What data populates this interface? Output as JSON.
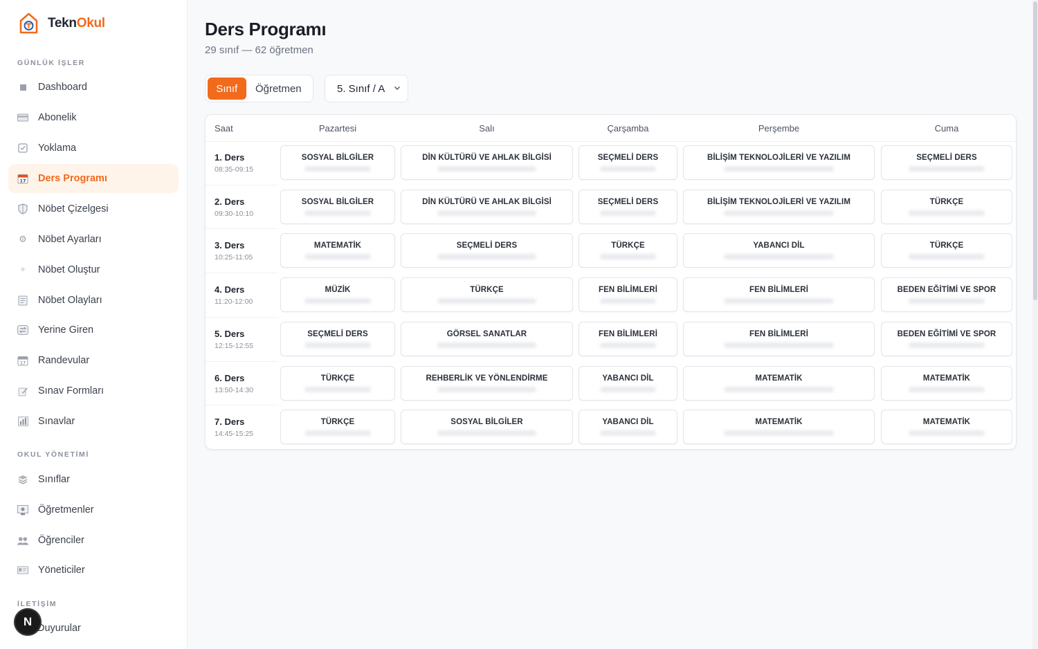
{
  "brand": {
    "name_part1": "Tekn",
    "name_part2": "Okul",
    "logo_color": "#f26a1b"
  },
  "sidebar": {
    "sections": [
      {
        "title": "GÜNLÜK İŞLER",
        "items": [
          {
            "label": "Dashboard",
            "icon": "square-icon",
            "active": false
          },
          {
            "label": "Abonelik",
            "icon": "card-icon",
            "active": false
          },
          {
            "label": "Yoklama",
            "icon": "checkbox-icon",
            "active": false
          },
          {
            "label": "Ders Programı",
            "icon": "calendar-icon",
            "active": true
          },
          {
            "label": "Nöbet Çizelgesi",
            "icon": "shield-icon",
            "active": false
          },
          {
            "label": "Nöbet Ayarları",
            "icon": "gear-icon",
            "active": false
          },
          {
            "label": "Nöbet Oluştur",
            "icon": "sparkle-icon",
            "active": false
          },
          {
            "label": "Nöbet Olayları",
            "icon": "document-icon",
            "active": false
          },
          {
            "label": "Yerine Giren",
            "icon": "swap-icon",
            "active": false
          },
          {
            "label": "Randevular",
            "icon": "calendar-icon",
            "active": false
          },
          {
            "label": "Sınav Formları",
            "icon": "pencil-icon",
            "active": false
          },
          {
            "label": "Sınavlar",
            "icon": "bar-chart-icon",
            "active": false
          }
        ]
      },
      {
        "title": "OKUL YÖNETİMİ",
        "items": [
          {
            "label": "Sınıflar",
            "icon": "books-icon",
            "active": false
          },
          {
            "label": "Öğretmenler",
            "icon": "teacher-icon",
            "active": false
          },
          {
            "label": "Öğrenciler",
            "icon": "users-icon",
            "active": false
          },
          {
            "label": "Yöneticiler",
            "icon": "id-card-icon",
            "active": false
          }
        ]
      },
      {
        "title": "İLETİŞİM",
        "items": [
          {
            "label": "Duyurular",
            "icon": "megaphone-icon",
            "active": false
          }
        ]
      }
    ],
    "avatar_letter": "N"
  },
  "header": {
    "title": "Ders Programı",
    "subtitle": "29 sınıf — 62 öğretmen"
  },
  "toolbar": {
    "toggle_class": "Sınıf",
    "toggle_teacher": "Öğretmen",
    "class_select_value": "5. Sınıf / A"
  },
  "schedule": {
    "time_header": "Saat",
    "days": [
      "Pazartesi",
      "Salı",
      "Çarşamba",
      "Perşembe",
      "Cuma"
    ],
    "periods": [
      {
        "name": "1. Ders",
        "time": "08:35-09:15",
        "subjects": [
          "SOSYAL BİLGİLER",
          "DİN KÜLTÜRÜ VE AHLAK BİLGİSİ",
          "SEÇMELİ DERS",
          "BİLİŞİM TEKNOLOJİLERİ VE YAZILIM",
          "SEÇMELİ DERS"
        ]
      },
      {
        "name": "2. Ders",
        "time": "09:30-10:10",
        "subjects": [
          "SOSYAL BİLGİLER",
          "DİN KÜLTÜRÜ VE AHLAK BİLGİSİ",
          "SEÇMELİ DERS",
          "BİLİŞİM TEKNOLOJİLERİ VE YAZILIM",
          "TÜRKÇE"
        ]
      },
      {
        "name": "3. Ders",
        "time": "10:25-11:05",
        "subjects": [
          "MATEMATİK",
          "SEÇMELİ DERS",
          "TÜRKÇE",
          "YABANCI DİL",
          "TÜRKÇE"
        ]
      },
      {
        "name": "4. Ders",
        "time": "11:20-12:00",
        "subjects": [
          "MÜZİK",
          "TÜRKÇE",
          "FEN BİLİMLERİ",
          "FEN BİLİMLERİ",
          "BEDEN EĞİTİMİ VE SPOR"
        ]
      },
      {
        "name": "5. Ders",
        "time": "12:15-12:55",
        "subjects": [
          "SEÇMELİ DERS",
          "GÖRSEL SANATLAR",
          "FEN BİLİMLERİ",
          "FEN BİLİMLERİ",
          "BEDEN EĞİTİMİ VE SPOR"
        ]
      },
      {
        "name": "6. Ders",
        "time": "13:50-14:30",
        "subjects": [
          "TÜRKÇE",
          "REHBERLİK VE YÖNLENDİRME",
          "YABANCI DİL",
          "MATEMATİK",
          "MATEMATİK"
        ]
      },
      {
        "name": "7. Ders",
        "time": "14:45-15:25",
        "subjects": [
          "TÜRKÇE",
          "SOSYAL BİLGİLER",
          "YABANCI DİL",
          "MATEMATİK",
          "MATEMATİK"
        ]
      }
    ]
  }
}
